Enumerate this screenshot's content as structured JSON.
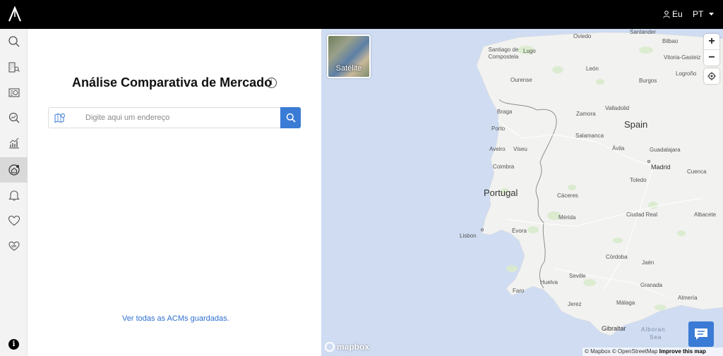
{
  "header": {
    "user_label": "Eu",
    "language": "PT"
  },
  "sidebar": {
    "items": [
      {
        "icon": "search-icon"
      },
      {
        "icon": "building-search-icon"
      },
      {
        "icon": "property-valuation-icon"
      },
      {
        "icon": "market-analysis-icon"
      },
      {
        "icon": "chart-growth-icon"
      },
      {
        "icon": "home-compare-icon",
        "active": true
      },
      {
        "icon": "bell-icon"
      },
      {
        "icon": "heart-icon"
      },
      {
        "icon": "handshake-heart-icon"
      }
    ],
    "info_label": "i"
  },
  "panel": {
    "title": "Análise Comparativa de Mercado",
    "info_label": "i",
    "search_placeholder": "Digite aqui um endereço",
    "saved_link": "Ver todas as ACMs guardadas."
  },
  "map": {
    "satellite_label": "Satélite",
    "zoom_in": "+",
    "zoom_out": "−",
    "labels": {
      "spain": "Spain",
      "portugal": "Portugal",
      "oviedo": "Oviedo",
      "santander": "Santander",
      "bilbao": "Bilbao",
      "vitoria": "Vitoria-Gasteiz",
      "santiago": "Santiago de Compostela",
      "lugo": "Lugo",
      "leon": "León",
      "burgos": "Burgos",
      "logrono": "Logroño",
      "ourense": "Ourense",
      "braga": "Braga",
      "porto": "Porto",
      "zamora": "Zamora",
      "valladolid": "Valladolid",
      "salamanca": "Salamanca",
      "aveiro": "Aveiro",
      "viseu": "Viseu",
      "avila": "Ávila",
      "guadalajara": "Guadalajara",
      "madrid": "Madrid",
      "coimbra": "Coimbra",
      "cuenca": "Cuenca",
      "toledo": "Toledo",
      "caceres": "Cáceres",
      "lisbon": "Lisbon",
      "evora": "Évora",
      "merida": "Mérida",
      "ciudad_real": "Ciudad Real",
      "albacete": "Albacete",
      "cordoba": "Córdoba",
      "jaen": "Jaén",
      "seville": "Seville",
      "huelva": "Huelva",
      "granada": "Granada",
      "faro": "Faro",
      "jerez": "Jerez",
      "malaga": "Málaga",
      "almeria": "Almería",
      "gibraltar": "Gibraltar",
      "alboran": "Alboran",
      "sea": "Sea"
    },
    "mapbox_label": "mapbox",
    "attribution": {
      "mapbox": "© Mapbox",
      "osm": "© OpenStreetMap",
      "improve": "Improve this map"
    }
  },
  "colors": {
    "accent": "#3a7bd5",
    "topbar": "#000000",
    "water": "#cfdcf2",
    "land": "#f2f2f0"
  }
}
